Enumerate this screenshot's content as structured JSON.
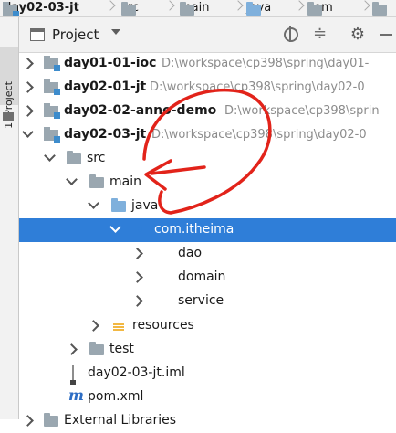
{
  "breadcrumbs": [
    {
      "label": "day02-03-jt",
      "icon": "module-icon",
      "bold": true
    },
    {
      "label": "src",
      "icon": "folder-icon",
      "bold": false
    },
    {
      "label": "main",
      "icon": "folder-icon",
      "bold": false
    },
    {
      "label": "java",
      "icon": "source-folder-icon",
      "bold": false
    },
    {
      "label": "com",
      "icon": "folder-icon",
      "bold": false
    },
    {
      "label": "i",
      "icon": "folder-icon",
      "bold": false
    }
  ],
  "tool_window": {
    "tab_label": "1: Project"
  },
  "project_header": {
    "title": "Project",
    "gear_glyph": "⚙"
  },
  "tree": [
    {
      "name": "day01-01-ioc",
      "path": "D:\\workspace\\cp398\\spring\\day01-",
      "depth": 0,
      "expanded": false,
      "icon": "module-icon",
      "bold": true
    },
    {
      "name": "day02-01-jt",
      "path": "D:\\workspace\\cp398\\spring\\day02-0",
      "depth": 0,
      "expanded": false,
      "icon": "module-icon",
      "bold": true
    },
    {
      "name": "day02-02-anno-demo",
      "path": "D:\\workspace\\cp398\\sprin",
      "depth": 0,
      "expanded": false,
      "icon": "module-icon",
      "bold": true
    },
    {
      "name": "day02-03-jt",
      "path": "D:\\workspace\\cp398\\spring\\day02-0",
      "depth": 0,
      "expanded": true,
      "icon": "module-icon",
      "bold": true
    },
    {
      "name": "src",
      "path": "",
      "depth": 1,
      "expanded": true,
      "icon": "folder-icon",
      "bold": false
    },
    {
      "name": "main",
      "path": "",
      "depth": 2,
      "expanded": true,
      "icon": "folder-icon",
      "bold": false
    },
    {
      "name": "java",
      "path": "",
      "depth": 3,
      "expanded": true,
      "icon": "source-folder-icon",
      "bold": false
    },
    {
      "name": "com.itheima",
      "path": "",
      "depth": 4,
      "expanded": true,
      "icon": "package-icon",
      "bold": false,
      "selected": true
    },
    {
      "name": "dao",
      "path": "",
      "depth": 5,
      "expanded": false,
      "icon": "package-icon",
      "bold": false
    },
    {
      "name": "domain",
      "path": "",
      "depth": 5,
      "expanded": false,
      "icon": "package-icon",
      "bold": false
    },
    {
      "name": "service",
      "path": "",
      "depth": 5,
      "expanded": false,
      "icon": "package-icon",
      "bold": false
    },
    {
      "name": "resources",
      "path": "",
      "depth": 3,
      "expanded": false,
      "icon": "resources-folder-icon",
      "bold": false
    },
    {
      "name": "test",
      "path": "",
      "depth": 2,
      "expanded": false,
      "icon": "folder-icon",
      "bold": false
    },
    {
      "name": "day02-03-jt.iml",
      "path": "",
      "depth": 2,
      "leaf": true,
      "icon": "iml-file-icon",
      "bold": false
    },
    {
      "name": "pom.xml",
      "path": "",
      "depth": 2,
      "leaf": true,
      "icon": "maven-icon",
      "bold": false
    },
    {
      "name": "External Libraries",
      "path": "",
      "depth": 0,
      "expanded": false,
      "icon": "library-icon",
      "bold": false
    }
  ],
  "colors": {
    "selection": "#2f7ed8",
    "annotation": "#e2231a"
  }
}
